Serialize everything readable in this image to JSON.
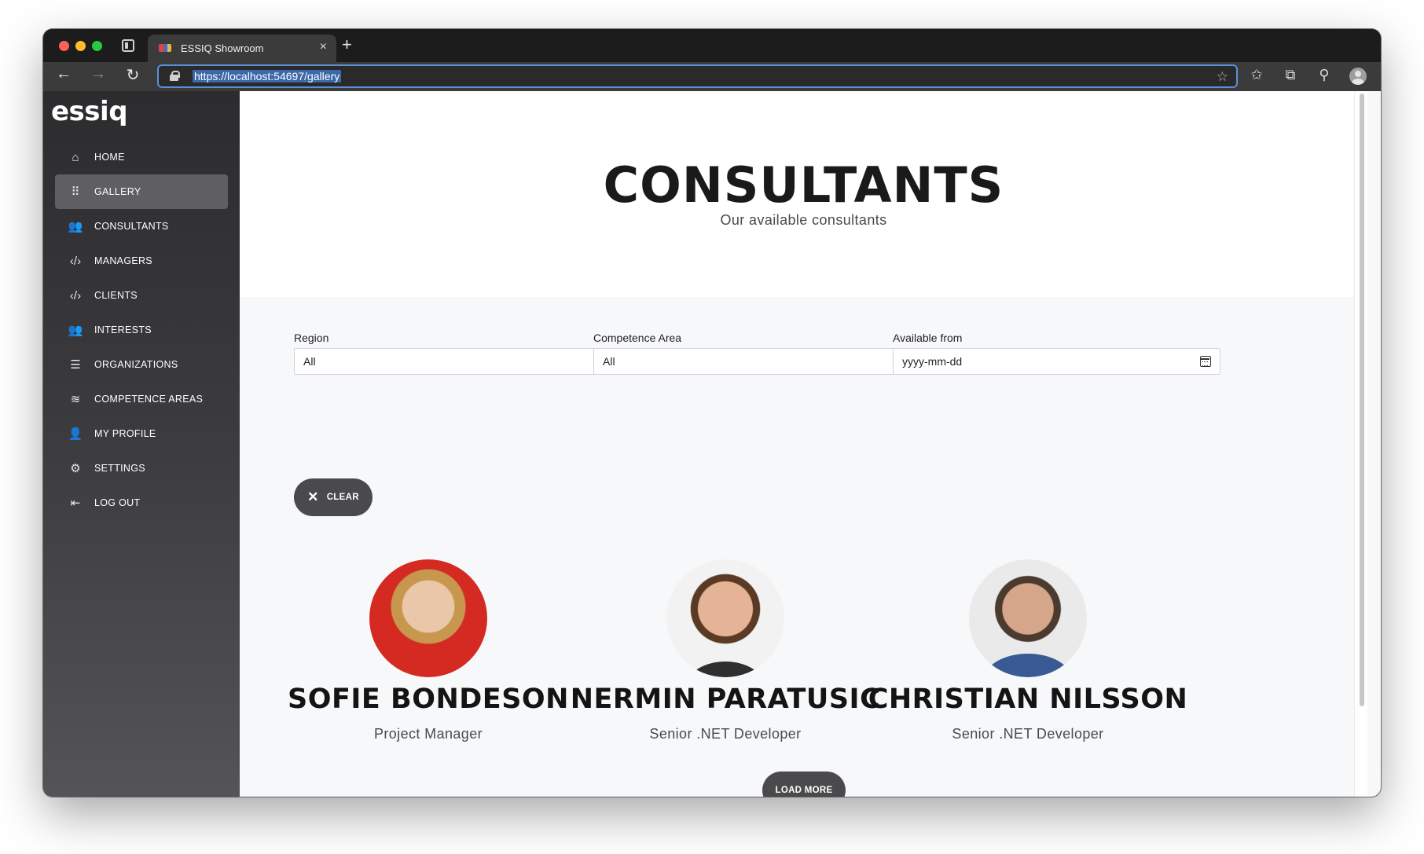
{
  "browser": {
    "tab_title": "ESSIQ Showroom",
    "tab_close": "×",
    "new_tab": "+",
    "url": "https://localhost:54697/gallery",
    "back": "←",
    "forward": "→",
    "reload": "↻",
    "more": "···"
  },
  "sidebar": {
    "logo": "essiq",
    "items": [
      {
        "label": "HOME",
        "icon": "home-icon",
        "glyph": "⌂"
      },
      {
        "label": "GALLERY",
        "icon": "grid-icon",
        "glyph": "⠿"
      },
      {
        "label": "CONSULTANTS",
        "icon": "users-icon",
        "glyph": "👥"
      },
      {
        "label": "MANAGERS",
        "icon": "code-icon",
        "glyph": "‹/›"
      },
      {
        "label": "CLIENTS",
        "icon": "code-icon",
        "glyph": "‹/›"
      },
      {
        "label": "INTERESTS",
        "icon": "users-icon",
        "glyph": "👥"
      },
      {
        "label": "ORGANIZATIONS",
        "icon": "list-icon",
        "glyph": "☰"
      },
      {
        "label": "COMPETENCE AREAS",
        "icon": "layers-icon",
        "glyph": "≋"
      },
      {
        "label": "MY PROFILE",
        "icon": "person-icon",
        "glyph": "👤"
      },
      {
        "label": "SETTINGS",
        "icon": "gear-icon",
        "glyph": "⚙"
      },
      {
        "label": "LOG OUT",
        "icon": "logout-icon",
        "glyph": "⇤"
      }
    ],
    "active_index": 1
  },
  "hero": {
    "title": "CONSULTANTS",
    "subtitle": "Our available consultants"
  },
  "filters": {
    "region": {
      "label": "Region",
      "value": "All"
    },
    "competence": {
      "label": "Competence Area",
      "value": "All"
    },
    "available": {
      "label": "Available from",
      "placeholder": "yyyy-mm-dd"
    }
  },
  "clear_button": {
    "label": "CLEAR",
    "icon": "x-icon",
    "glyph": "✕"
  },
  "consultants": [
    {
      "name": "SOFIE BONDESON",
      "role": "Project Manager"
    },
    {
      "name": "NERMIN PARATUSIC",
      "role": "Senior .NET Developer"
    },
    {
      "name": "CHRISTIAN NILSSON",
      "role": "Senior .NET Developer"
    }
  ],
  "load_more": {
    "label": "LOAD MORE"
  },
  "colors": {
    "accent": "#1d6fe0",
    "button": "#4a4a4d",
    "sidebar_active": "#5f5f62"
  }
}
